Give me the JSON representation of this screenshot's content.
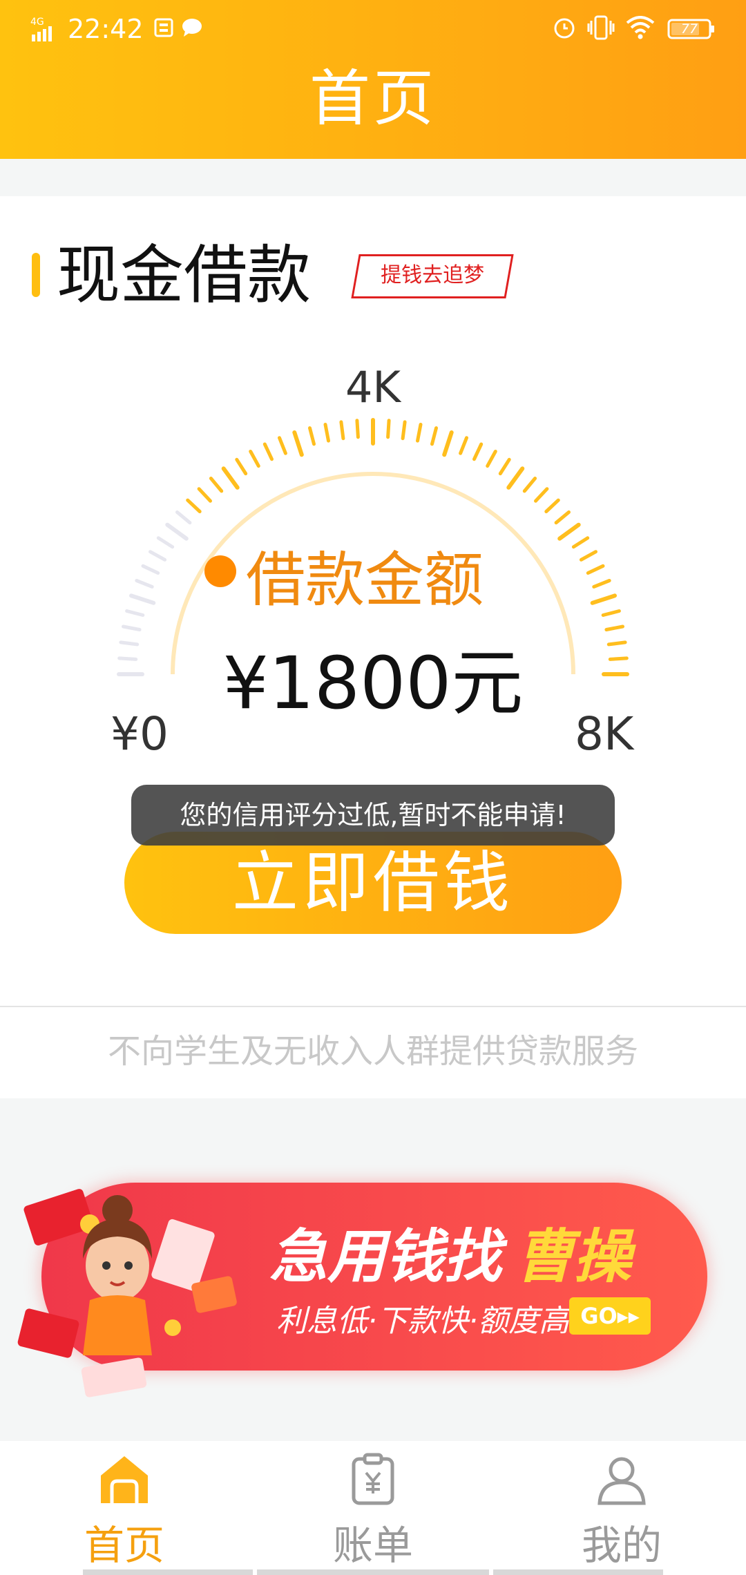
{
  "status_bar": {
    "network": "4G",
    "time": "22:42",
    "battery": "77"
  },
  "header": {
    "title": "首页"
  },
  "loan": {
    "section_title": "现金借款",
    "slogan": "提钱去追梦",
    "gauge": {
      "min_label": "¥0",
      "mid_label": "4K",
      "max_label": "8K",
      "min": 0,
      "max": 8000,
      "value": 1800
    },
    "amount_label": "借款金额",
    "amount_value": "¥1800元",
    "button_label": "立即借钱"
  },
  "toast": {
    "message": "您的信用评分过低,暂时不能申请!"
  },
  "disclaimer": "不向学生及无收入人群提供贷款服务",
  "banner": {
    "title_part1": "急用钱找",
    "title_part2": "曹操",
    "subtitle": "利息低·下款快·额度高",
    "go_label": "GO▸▸"
  },
  "tabbar": {
    "items": [
      {
        "label": "首页",
        "active": true
      },
      {
        "label": "账单",
        "active": false
      },
      {
        "label": "我的",
        "active": false
      }
    ],
    "active_color": "#f5a00f",
    "inactive_color": "#9a9a9a"
  },
  "colors": {
    "brand_gradient_start": "#ffc20f",
    "brand_gradient_end": "#ff9f13",
    "accent_orange": "#f08a10",
    "tag_red": "#e02020"
  }
}
